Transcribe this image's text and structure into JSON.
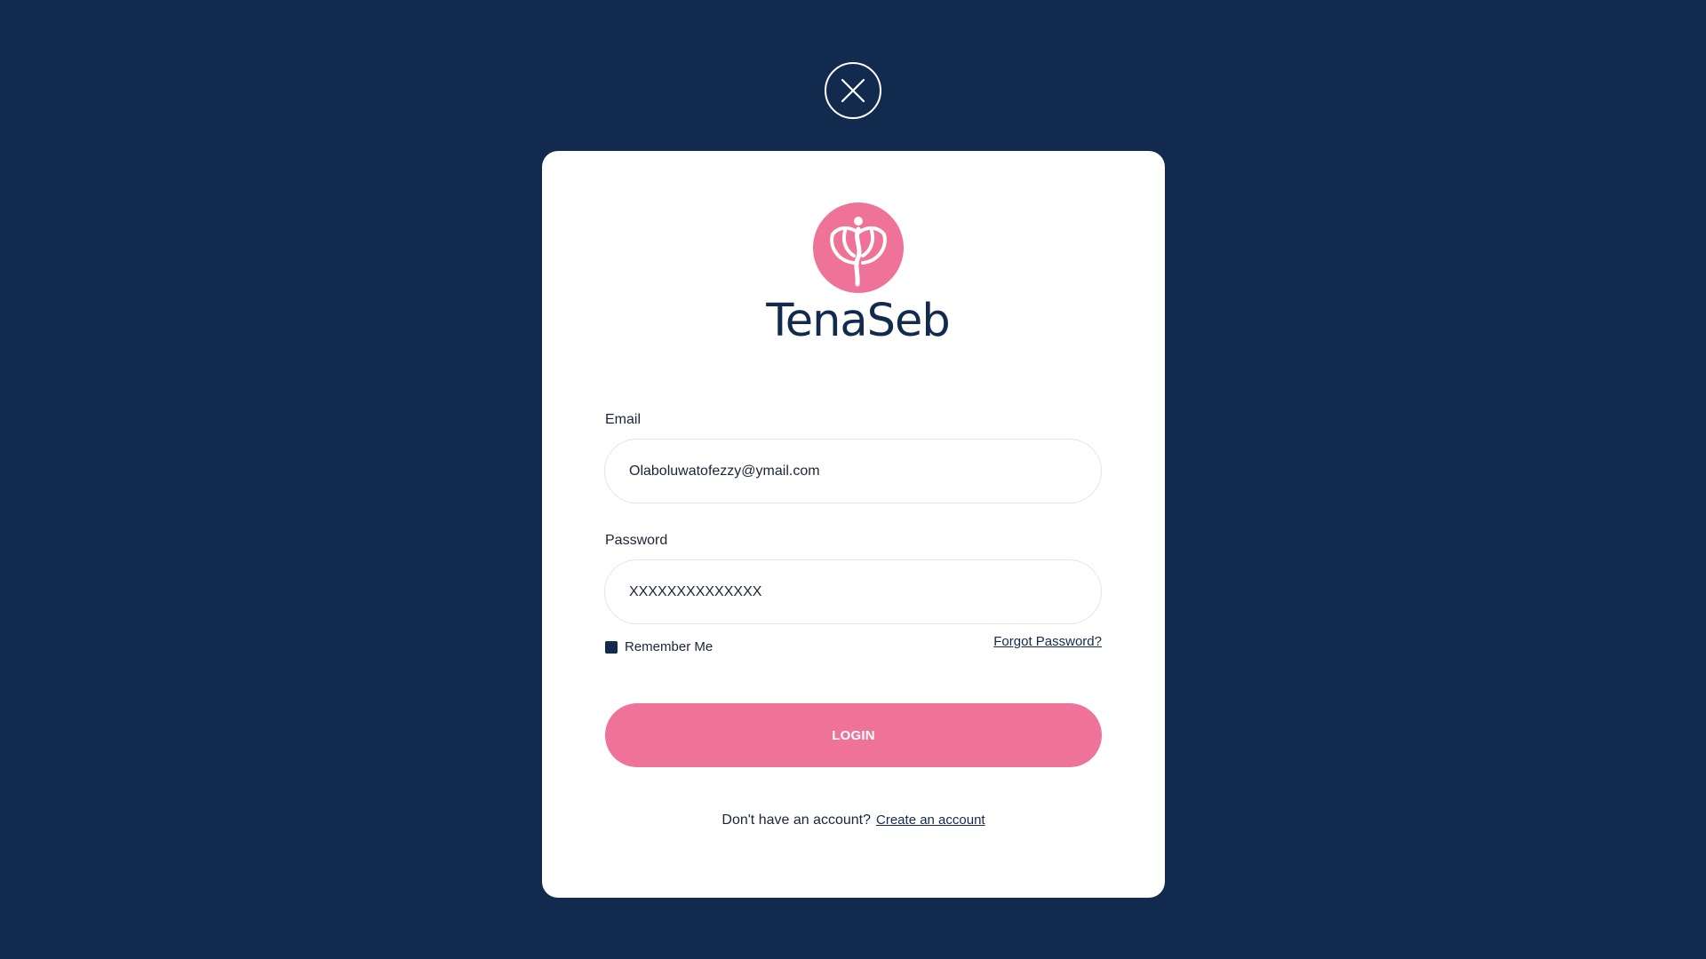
{
  "modal": {
    "close_icon": "close-icon",
    "brand": {
      "logo_icon": "lotus-figure-logo",
      "name": "TenaSeb",
      "logo_color": "#ef7298"
    },
    "email": {
      "label": "Email",
      "value": "Olaboluwatofezzy@ymail.com"
    },
    "password": {
      "label": "Password",
      "value": "XXXXXXXXXXXXXX"
    },
    "remember_me": {
      "label": "Remember Me",
      "checked": true
    },
    "forgot_password": "Forgot Password?",
    "login_button": "LOGIN",
    "signup_prompt": "Don't have an account?",
    "signup_link": "Create an account"
  },
  "colors": {
    "background": "#132a4f",
    "accent": "#ef7298",
    "card": "#ffffff"
  }
}
